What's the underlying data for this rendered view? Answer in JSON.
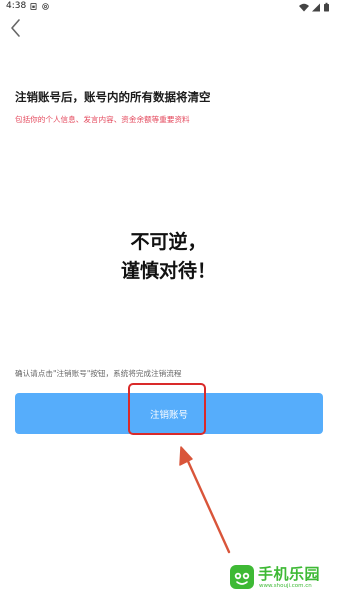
{
  "status_bar": {
    "time": "4:38",
    "icons": [
      "sim-card-icon",
      "at-sign-icon",
      "wifi-icon",
      "signal-icon",
      "battery-icon"
    ]
  },
  "header": {
    "back_icon": "chevron-left-icon"
  },
  "content": {
    "title": "注销账号后，账号内的所有数据将清空",
    "note": "包括你的个人信息、发言内容、资金余额等重要资料",
    "warning_line1": "不可逆，",
    "warning_line2": "谨慎对待！",
    "confirm_hint": "确认请点击\"注销账号\"按钮，系统将完成注销流程",
    "button_label": "注销账号"
  },
  "annotation": {
    "highlight_color": "#d92a2a",
    "arrow_color": "#d9553a"
  },
  "watermark": {
    "name": "手机乐园",
    "url": "www.shouji.com.cn"
  },
  "colors": {
    "button": "#56adfb",
    "note": "#e4485c",
    "watermark": "#3eb935"
  }
}
